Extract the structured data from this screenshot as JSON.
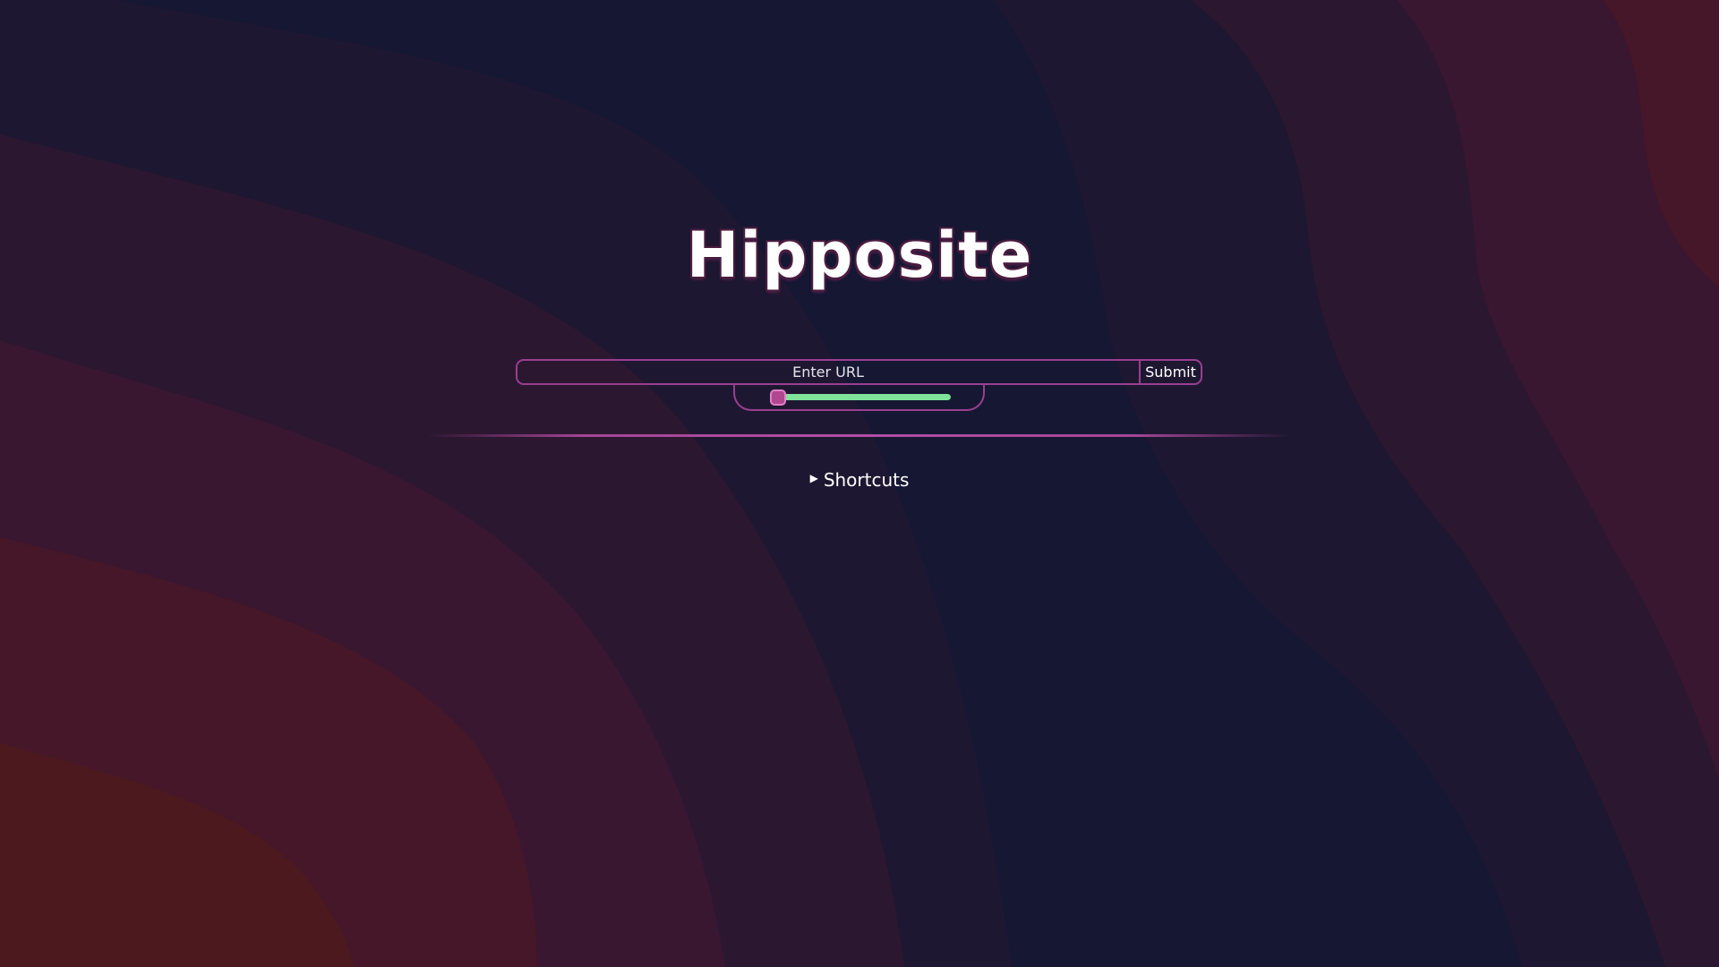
{
  "page": {
    "title": "Hipposite"
  },
  "search": {
    "placeholder": "Enter URL",
    "value": "",
    "submit_label": "Submit"
  },
  "slider": {
    "value_fraction": 0.0
  },
  "shortcuts": {
    "toggle_icon": "triangle-right-icon",
    "toggle_glyph": "▶",
    "label": "Shortcuts",
    "expanded": false
  },
  "theme": {
    "accent": "#9a3f8f",
    "slider_fill": "#7fe39a",
    "slider_thumb": "#b0488f",
    "text": "#ffffff",
    "background_colors": [
      "#151733",
      "#1e1731",
      "#2c1730",
      "#391730",
      "#451728",
      "#4c1a1e"
    ]
  }
}
